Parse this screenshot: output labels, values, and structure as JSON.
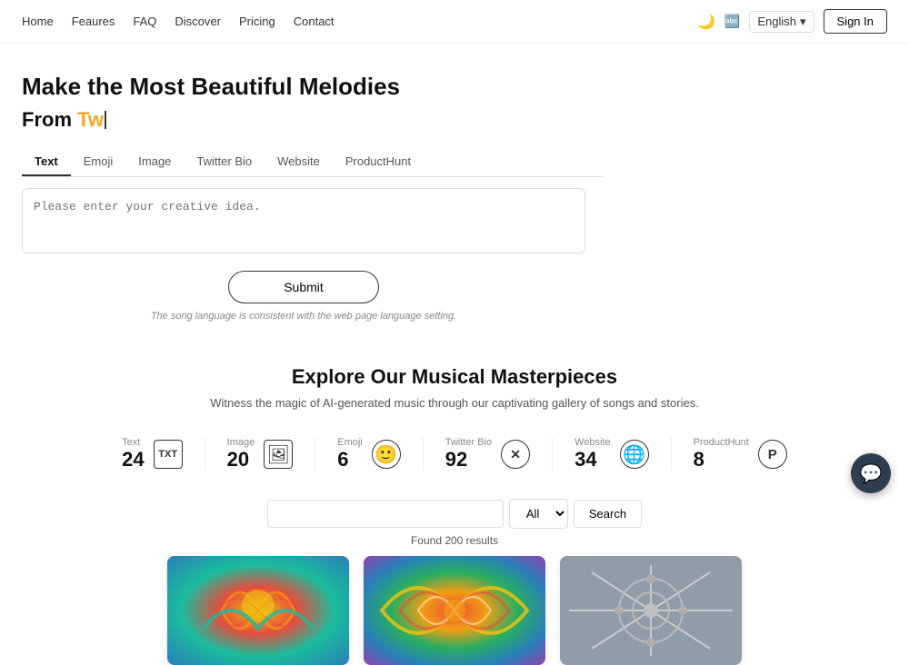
{
  "nav": {
    "links": [
      {
        "label": "Home",
        "id": "home"
      },
      {
        "label": "Feaures",
        "id": "features"
      },
      {
        "label": "FAQ",
        "id": "faq"
      },
      {
        "label": "Discover",
        "id": "discover"
      },
      {
        "label": "Pricing",
        "id": "pricing"
      },
      {
        "label": "Contact",
        "id": "contact"
      }
    ],
    "lang_label": "English",
    "sign_in_label": "Sign In"
  },
  "hero": {
    "title": "Make the Most Beautiful Melodies",
    "from_label": "From",
    "from_typed": "Tw",
    "tabs": [
      "Text",
      "Emoji",
      "Image",
      "Twitter Bio",
      "Website",
      "ProductHunt"
    ],
    "active_tab": "Text",
    "textarea_placeholder": "Please enter your creative idea.",
    "submit_label": "Submit",
    "lang_note": "The song language is consistent with the web page language setting."
  },
  "explore": {
    "title": "Explore Our Musical Masterpieces",
    "subtitle": "Witness the magic of AI-generated music through our captivating gallery of songs and stories."
  },
  "stats": [
    {
      "type": "Text",
      "number": "24",
      "icon": "TXT",
      "icon_type": "text"
    },
    {
      "type": "Image",
      "number": "20",
      "icon": "🖼",
      "icon_type": "emoji"
    },
    {
      "type": "Emoji",
      "number": "6",
      "icon": "🙂",
      "icon_type": "emoji"
    },
    {
      "type": "Twitter Bio",
      "number": "92",
      "icon": "✕",
      "icon_type": "text"
    },
    {
      "type": "Website",
      "number": "34",
      "icon": "🌐",
      "icon_type": "emoji"
    },
    {
      "type": "ProductHunt",
      "number": "8",
      "icon": "P",
      "icon_type": "text"
    }
  ],
  "search": {
    "placeholder": "",
    "filter_options": [
      "All"
    ],
    "filter_default": "All",
    "button_label": "Search",
    "results_text": "Found 200 results"
  },
  "gallery": [
    {
      "id": "card1",
      "style": "img1"
    },
    {
      "id": "card2",
      "style": "img2"
    },
    {
      "id": "card3",
      "style": "img3"
    }
  ],
  "chat": {
    "icon": "💬"
  }
}
